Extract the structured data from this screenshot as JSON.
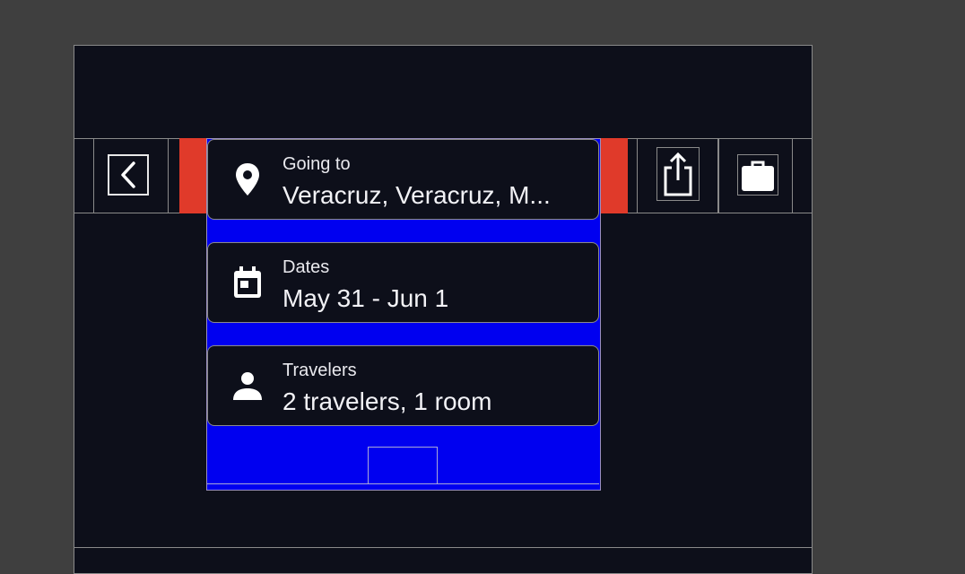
{
  "search": {
    "destination": {
      "label": "Going to",
      "value": "Veracruz, Veracruz, M...",
      "icon": "location-pin-icon"
    },
    "dates": {
      "label": "Dates",
      "value": "May 31 - Jun 1",
      "icon": "calendar-icon"
    },
    "travelers": {
      "label": "Travelers",
      "value": "2 travelers, 1 room",
      "icon": "person-icon"
    }
  },
  "toolbar": {
    "back_icon": "chevron-left-icon",
    "share_icon": "share-icon",
    "trips_icon": "briefcase-icon"
  },
  "colors": {
    "background": "#0d0f1a",
    "panel": "#0000f0",
    "accent_red": "#e03a2a",
    "text": "#f2f2f6"
  }
}
